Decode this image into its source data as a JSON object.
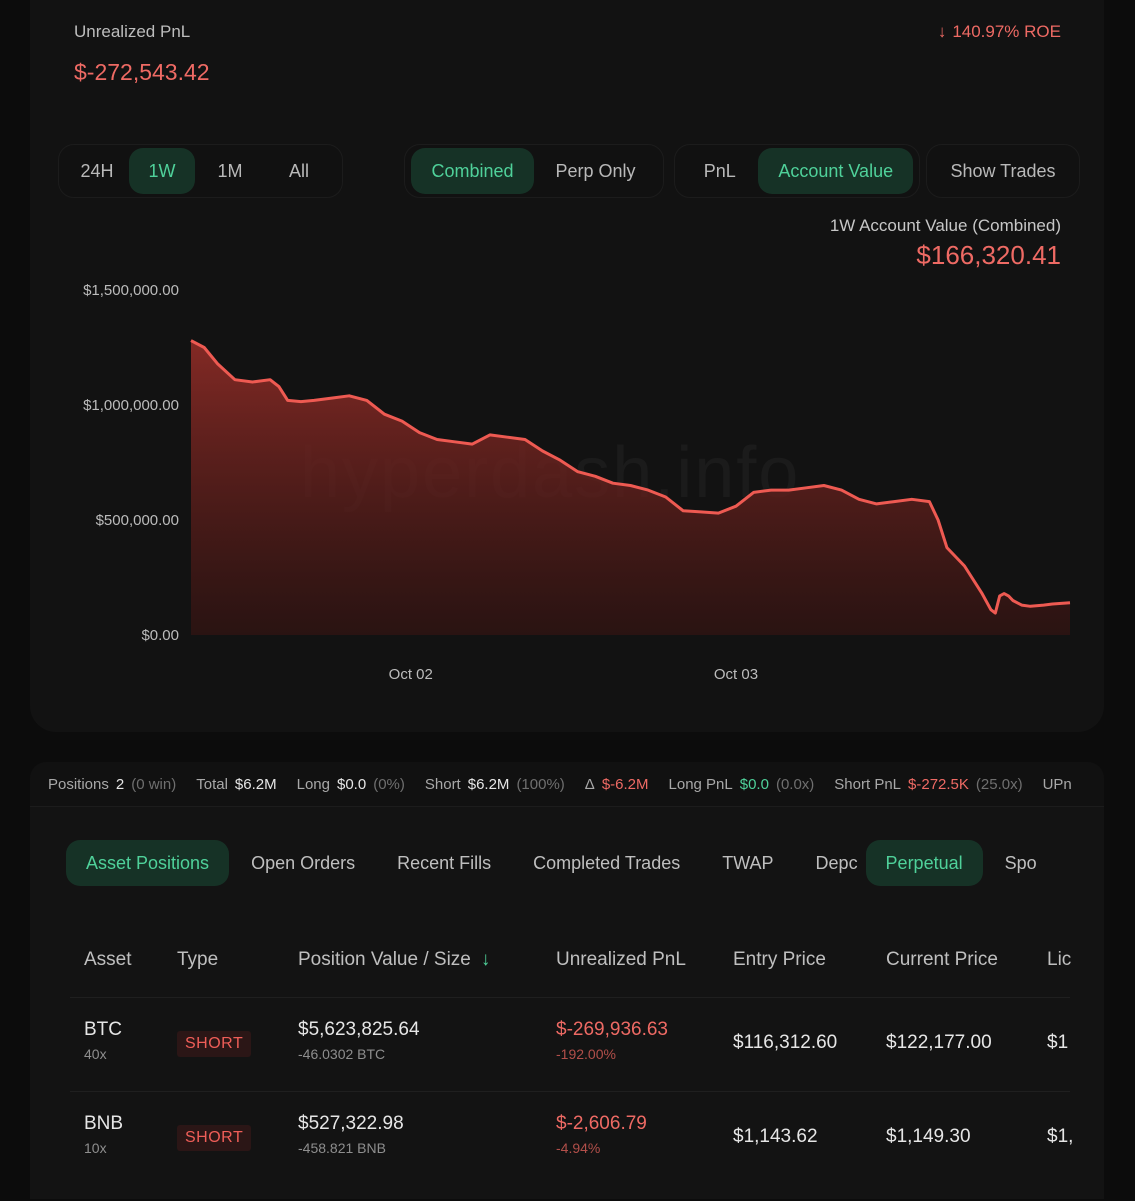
{
  "header": {
    "unrealized_label": "Unrealized PnL",
    "unrealized_value": "$-272,543.42",
    "roe_arrow": "↓",
    "roe_text": "140.97% ROE"
  },
  "controls": {
    "timeframes": [
      "24H",
      "1W",
      "1M",
      "All"
    ],
    "timeframe_active": "1W",
    "scope": [
      "Combined",
      "Perp Only"
    ],
    "scope_active": "Combined",
    "metric": [
      "PnL",
      "Account Value"
    ],
    "metric_active": "Account Value",
    "show_trades": "Show Trades"
  },
  "chart_caption": "1W Account Value (Combined)",
  "chart_value": "$166,320.41",
  "watermark": "hyperdash.info",
  "chart_data": {
    "type": "area",
    "title": "",
    "y_tick_labels": [
      "$1,500,000.00",
      "$1,000,000.00",
      "$500,000.00",
      "$0.00"
    ],
    "y_ticks": [
      1500000,
      1000000,
      500000,
      0
    ],
    "x_tick_labels": [
      "Oct 02",
      "Oct 03"
    ],
    "x_ticks": [
      0.25,
      0.62
    ],
    "ylim": [
      0,
      1500000
    ],
    "xlim": [
      0,
      1
    ],
    "line_color": "#ee5a52",
    "series": [
      {
        "x": [
          0.0,
          0.015,
          0.03,
          0.05,
          0.07,
          0.09,
          0.1,
          0.11,
          0.125,
          0.14,
          0.16,
          0.18,
          0.2,
          0.22,
          0.24,
          0.26,
          0.28,
          0.3,
          0.32,
          0.34,
          0.36,
          0.38,
          0.4,
          0.42,
          0.44,
          0.46,
          0.48,
          0.5,
          0.52,
          0.54,
          0.56,
          0.58,
          0.6,
          0.62,
          0.64,
          0.66,
          0.68,
          0.7,
          0.72,
          0.74,
          0.76,
          0.78,
          0.8,
          0.82,
          0.84,
          0.85,
          0.86,
          0.88,
          0.9,
          0.91,
          0.915,
          0.92,
          0.925,
          0.93,
          0.935,
          0.94,
          0.945,
          0.955,
          0.97,
          0.98,
          1.0
        ],
        "y": [
          1280000,
          1250000,
          1180000,
          1110000,
          1100000,
          1110000,
          1080000,
          1020000,
          1015000,
          1020000,
          1030000,
          1040000,
          1020000,
          960000,
          930000,
          880000,
          850000,
          840000,
          830000,
          870000,
          860000,
          850000,
          800000,
          760000,
          710000,
          690000,
          660000,
          650000,
          630000,
          600000,
          540000,
          535000,
          530000,
          560000,
          620000,
          630000,
          630000,
          640000,
          650000,
          630000,
          590000,
          570000,
          580000,
          590000,
          580000,
          500000,
          380000,
          300000,
          180000,
          110000,
          95000,
          170000,
          180000,
          170000,
          150000,
          140000,
          130000,
          125000,
          130000,
          135000,
          140000
        ]
      }
    ]
  },
  "stats": [
    {
      "label": "Positions",
      "value": "2",
      "sub": "(0 win)"
    },
    {
      "label": "Total",
      "value": "$6.2M"
    },
    {
      "label": "Long",
      "value": "$0.0",
      "sub": "(0%)"
    },
    {
      "label": "Short",
      "value": "$6.2M",
      "sub": "(100%)"
    },
    {
      "label": "Δ",
      "neg": "$-6.2M"
    },
    {
      "label": "Long PnL",
      "pos": "$0.0",
      "sub": "(0.0x)"
    },
    {
      "label": "Short PnL",
      "neg": "$-272.5K",
      "sub": "(25.0x)"
    },
    {
      "label": "UPn"
    }
  ],
  "tabs": [
    "Asset Positions",
    "Open Orders",
    "Recent Fills",
    "Completed Trades",
    "TWAP",
    "Depc"
  ],
  "tab_active": "Asset Positions",
  "tabs_right": [
    "Perpetual",
    "Spo"
  ],
  "tabs_right_active": "Perpetual",
  "table": {
    "headers": {
      "asset": "Asset",
      "type": "Type",
      "position": "Position Value / Size",
      "sort_icon": "↓",
      "upnl": "Unrealized PnL",
      "entry": "Entry Price",
      "current": "Current Price",
      "liq": "Lic"
    },
    "rows": [
      {
        "asset": "BTC",
        "leverage": "40x",
        "type": "SHORT",
        "value": "$5,623,825.64",
        "size": "-46.0302 BTC",
        "upnl": "$-269,936.63",
        "upnl_pct": "-192.00%",
        "entry": "$116,312.60",
        "current": "$122,177.00",
        "liq": "$1"
      },
      {
        "asset": "BNB",
        "leverage": "10x",
        "type": "SHORT",
        "value": "$527,322.98",
        "size": "-458.821 BNB",
        "upnl": "$-2,606.79",
        "upnl_pct": "-4.94%",
        "entry": "$1,143.62",
        "current": "$1,149.30",
        "liq": "$1,"
      }
    ]
  }
}
